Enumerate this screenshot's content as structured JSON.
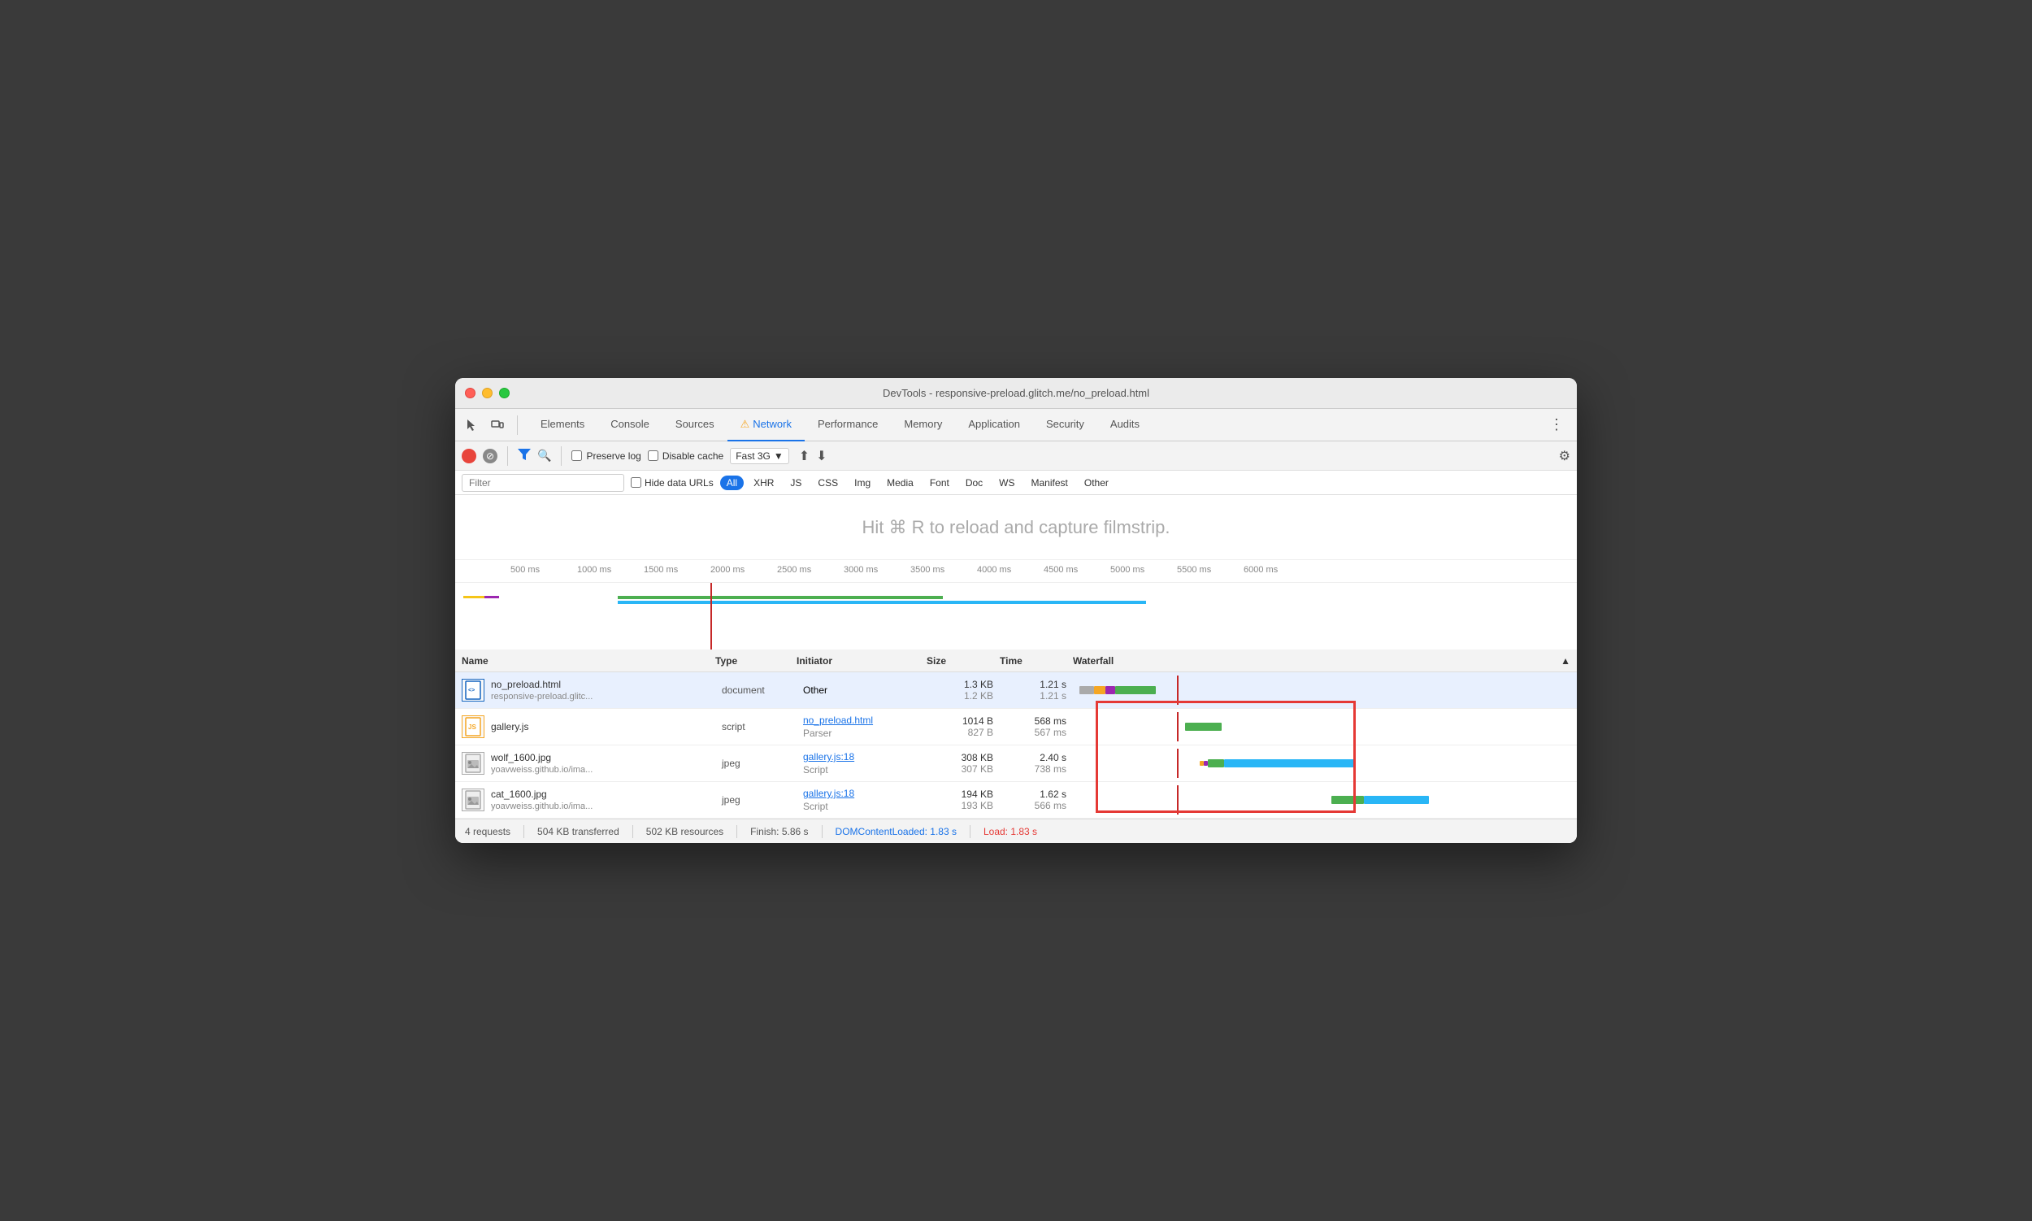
{
  "window": {
    "title": "DevTools - responsive-preload.glitch.me/no_preload.html"
  },
  "nav": {
    "tabs": [
      {
        "label": "Elements",
        "active": false
      },
      {
        "label": "Console",
        "active": false
      },
      {
        "label": "Sources",
        "active": false
      },
      {
        "label": "Network",
        "active": true,
        "warning": true
      },
      {
        "label": "Performance",
        "active": false
      },
      {
        "label": "Memory",
        "active": false
      },
      {
        "label": "Application",
        "active": false
      },
      {
        "label": "Security",
        "active": false
      },
      {
        "label": "Audits",
        "active": false
      }
    ]
  },
  "toolbar": {
    "preserve_log": "Preserve log",
    "disable_cache": "Disable cache",
    "throttle": "Fast 3G",
    "settings_icon": "⚙"
  },
  "filter": {
    "placeholder": "Filter",
    "hide_data_urls": "Hide data URLs",
    "types": [
      "All",
      "XHR",
      "JS",
      "CSS",
      "Img",
      "Media",
      "Font",
      "Doc",
      "WS",
      "Manifest",
      "Other"
    ]
  },
  "filmstrip": {
    "message": "Hit ⌘ R to reload and capture filmstrip."
  },
  "timeline": {
    "ticks": [
      "500 ms",
      "1000 ms",
      "1500 ms",
      "2000 ms",
      "2500 ms",
      "3000 ms",
      "3500 ms",
      "4000 ms",
      "4500 ms",
      "5000 ms",
      "5500 ms",
      "6000 ms"
    ]
  },
  "table": {
    "headers": [
      "Name",
      "Type",
      "Initiator",
      "Size",
      "Time",
      "Waterfall"
    ],
    "rows": [
      {
        "icon_type": "html",
        "icon_label": "HTML",
        "filename": "no_preload.html",
        "domain": "responsive-preload.glitc...",
        "type": "document",
        "initiator": "Other",
        "initiator_link": false,
        "size_main": "1.3 KB",
        "size_sub": "1.2 KB",
        "time_main": "1.21 s",
        "time_sub": "1.21 s",
        "selected": true
      },
      {
        "icon_type": "js",
        "icon_label": "JS",
        "filename": "gallery.js",
        "domain": "",
        "type": "script",
        "initiator": "no_preload.html",
        "initiator_sub": "Parser",
        "initiator_link": true,
        "size_main": "1014 B",
        "size_sub": "827 B",
        "time_main": "568 ms",
        "time_sub": "567 ms",
        "selected": false
      },
      {
        "icon_type": "img",
        "icon_label": "IMG",
        "filename": "wolf_1600.jpg",
        "domain": "yoavweiss.github.io/ima...",
        "type": "jpeg",
        "initiator": "gallery.js:18",
        "initiator_sub": "Script",
        "initiator_link": true,
        "size_main": "308 KB",
        "size_sub": "307 KB",
        "time_main": "2.40 s",
        "time_sub": "738 ms",
        "selected": false
      },
      {
        "icon_type": "img",
        "icon_label": "IMG",
        "filename": "cat_1600.jpg",
        "domain": "yoavweiss.github.io/ima...",
        "type": "jpeg",
        "initiator": "gallery.js:18",
        "initiator_sub": "Script",
        "initiator_link": true,
        "size_main": "194 KB",
        "size_sub": "193 KB",
        "time_main": "1.62 s",
        "time_sub": "566 ms",
        "selected": false
      }
    ]
  },
  "statusbar": {
    "requests": "4 requests",
    "transferred": "504 KB transferred",
    "resources": "502 KB resources",
    "finish": "Finish: 5.86 s",
    "dcl": "DOMContentLoaded: 1.83 s",
    "load": "Load: 1.83 s"
  }
}
